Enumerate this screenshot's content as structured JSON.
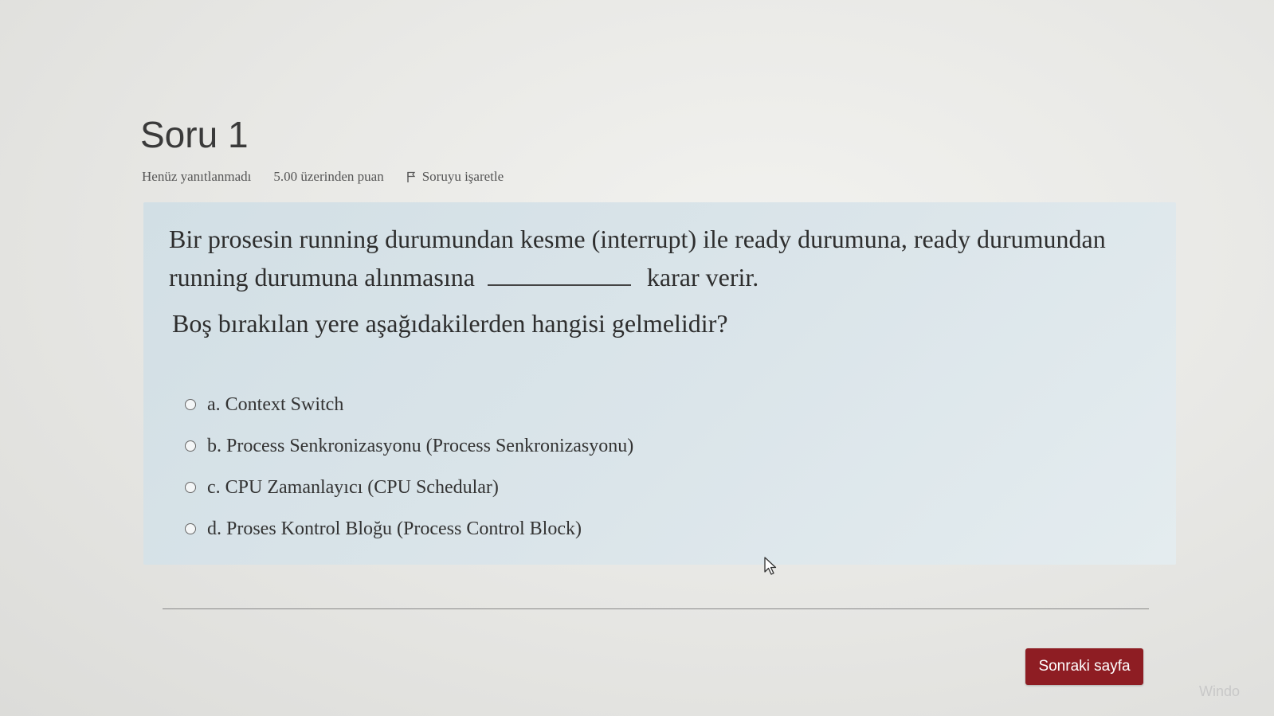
{
  "question": {
    "title": "Soru 1",
    "status": "Henüz yanıtlanmadı",
    "points": "5.00 üzerinden puan",
    "flag_label": "Soruyu işaretle",
    "text_before_blank": "Bir prosesin running durumundan kesme (interrupt) ile ready durumuna, ready durumundan running durumuna alınmasına",
    "text_after_blank": "karar verir.",
    "prompt": "Boş bırakılan yere aşağıdakilerden hangisi gelmelidir?"
  },
  "answers": [
    {
      "label": "a. Context Switch"
    },
    {
      "label": "b. Process Senkronizasyonu (Process Senkronizasyonu)"
    },
    {
      "label": "c. CPU Zamanlayıcı (CPU Schedular)"
    },
    {
      "label": "d. Proses Kontrol Bloğu (Process Control Block)"
    }
  ],
  "navigation": {
    "next_label": "Sonraki sayfa"
  },
  "watermark": "Windo",
  "colors": {
    "question_bg": "#d8e3e8",
    "next_button": "#8e1d23"
  },
  "icons": {
    "flag": "flag-icon",
    "radio": "radio-icon",
    "cursor": "mouse-cursor-icon"
  }
}
